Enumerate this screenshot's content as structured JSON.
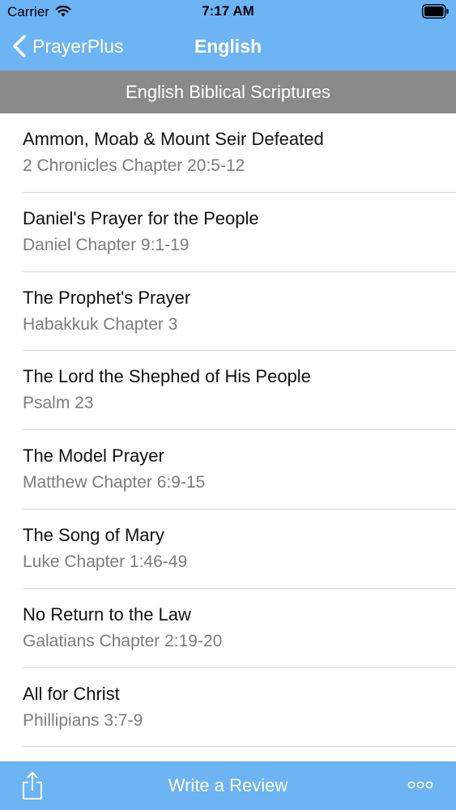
{
  "status_bar": {
    "carrier": "Carrier",
    "time": "7:17 AM"
  },
  "nav": {
    "back_label": "PrayerPlus",
    "title": "English"
  },
  "section_header": "English Biblical Scriptures",
  "items": [
    {
      "title": "Ammon, Moab & Mount Seir Defeated",
      "subtitle": "2 Chronicles Chapter 20:5-12"
    },
    {
      "title": "Daniel's Prayer for the People",
      "subtitle": "Daniel Chapter 9:1-19"
    },
    {
      "title": "The Prophet's Prayer",
      "subtitle": "Habakkuk Chapter 3"
    },
    {
      "title": "The Lord the Shephed of His People",
      "subtitle": "Psalm 23"
    },
    {
      "title": "The Model Prayer",
      "subtitle": "Matthew Chapter 6:9-15"
    },
    {
      "title": "The Song of Mary",
      "subtitle": "Luke Chapter 1:46-49"
    },
    {
      "title": "No Return to the Law",
      "subtitle": "Galatians Chapter 2:19-20"
    },
    {
      "title": "All for Christ",
      "subtitle": "Phillipians 3:7-9"
    }
  ],
  "toolbar": {
    "review_label": "Write a Review",
    "share_icon": "share-icon",
    "more_icon": "more-icon"
  },
  "colors": {
    "bar_blue": "#6cb4f3",
    "header_gray": "#8a8a8a",
    "subtitle_gray": "#7d7d7d"
  }
}
